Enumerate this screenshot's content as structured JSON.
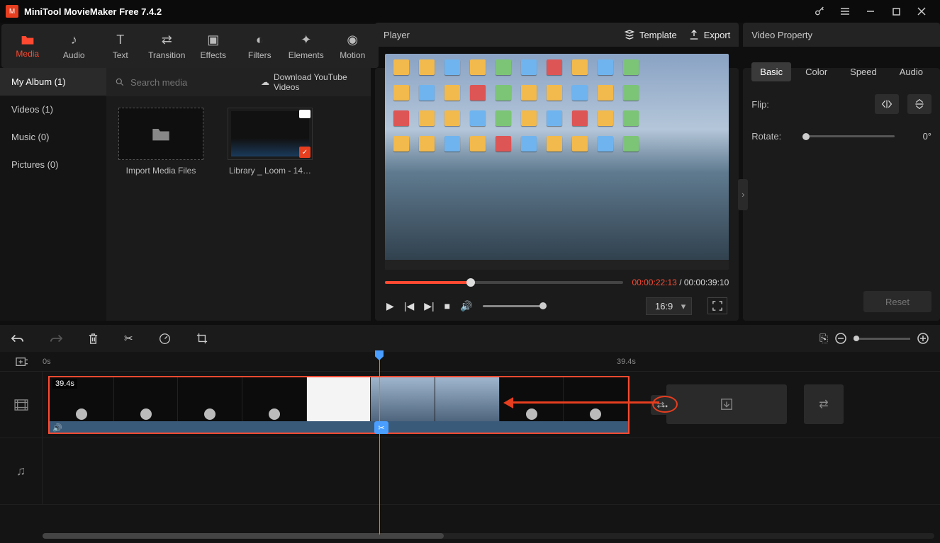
{
  "app": {
    "title": "MiniTool MovieMaker Free 7.4.2"
  },
  "toolbar": {
    "items": [
      {
        "label": "Media",
        "icon": "folder"
      },
      {
        "label": "Audio",
        "icon": "music"
      },
      {
        "label": "Text",
        "icon": "text"
      },
      {
        "label": "Transition",
        "icon": "transition"
      },
      {
        "label": "Effects",
        "icon": "effects"
      },
      {
        "label": "Filters",
        "icon": "filters"
      },
      {
        "label": "Elements",
        "icon": "elements"
      },
      {
        "label": "Motion",
        "icon": "motion"
      }
    ]
  },
  "mediaSidebar": {
    "items": [
      {
        "label": "My Album (1)"
      },
      {
        "label": "Videos (1)"
      },
      {
        "label": "Music (0)"
      },
      {
        "label": "Pictures (0)"
      }
    ]
  },
  "mediaSearch": {
    "placeholder": "Search media",
    "download": "Download YouTube Videos"
  },
  "mediaTiles": {
    "import": "Import Media Files",
    "clip1": "Library _ Loom - 14…"
  },
  "player": {
    "label": "Player",
    "template": "Template",
    "export": "Export",
    "currentTime": "00:00:22:13",
    "sep": " / ",
    "totalTime": "00:00:39:10",
    "ratio": "16:9"
  },
  "property": {
    "label": "Video Property",
    "tabs": [
      "Basic",
      "Color",
      "Speed",
      "Audio"
    ],
    "flipLabel": "Flip:",
    "rotateLabel": "Rotate:",
    "rotateValue": "0°",
    "reset": "Reset"
  },
  "ruler": {
    "t0": "0s",
    "t1": "39.4s"
  },
  "clip": {
    "duration": "39.4s"
  }
}
